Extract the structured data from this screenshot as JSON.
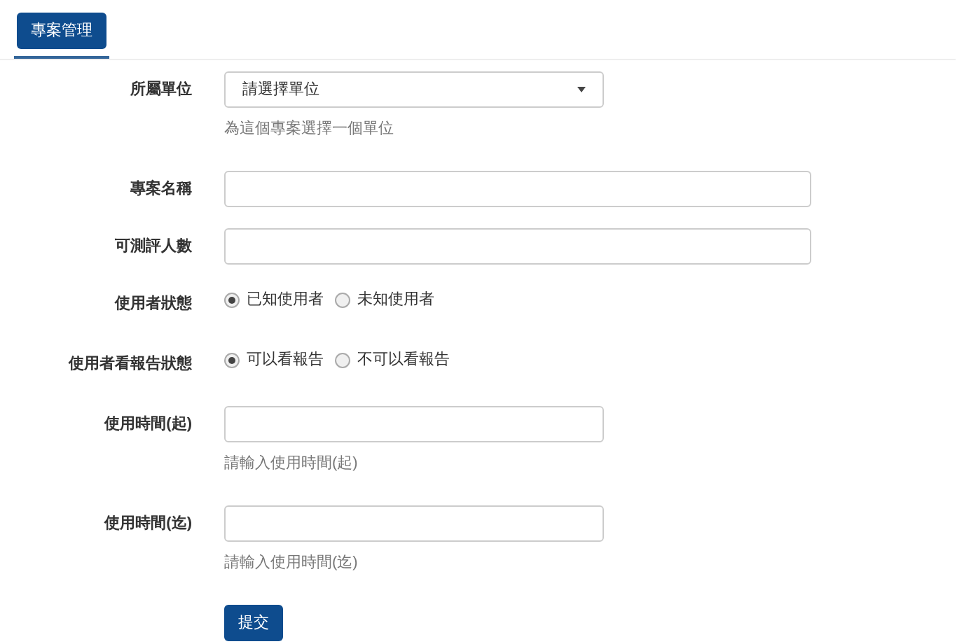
{
  "tabs": [
    {
      "label": "專案管理",
      "selected": true
    }
  ],
  "fields": [
    {
      "kind": "select",
      "label": "所屬單位",
      "value": "請選擇單位",
      "help": "為這個專案選擇一個單位"
    },
    {
      "kind": "text",
      "label": "專案名稱"
    },
    {
      "kind": "text",
      "label": "可測評人數"
    },
    {
      "kind": "radio",
      "label": "使用者狀態",
      "options": [
        {
          "label": "已知使用者",
          "selected": true
        },
        {
          "label": "未知使用者",
          "selected": false
        }
      ]
    },
    {
      "kind": "radio",
      "label": "使用者看報告狀態",
      "options": [
        {
          "label": "可以看報告",
          "selected": true
        },
        {
          "label": "不可以看報告",
          "selected": false
        }
      ]
    },
    {
      "kind": "text",
      "label": "使用時間(起)",
      "help": "請輸入使用時間(起)"
    },
    {
      "kind": "text",
      "label": "使用時間(迄)",
      "help": "請輸入使用時間(迄)"
    }
  ],
  "submit": "提交"
}
